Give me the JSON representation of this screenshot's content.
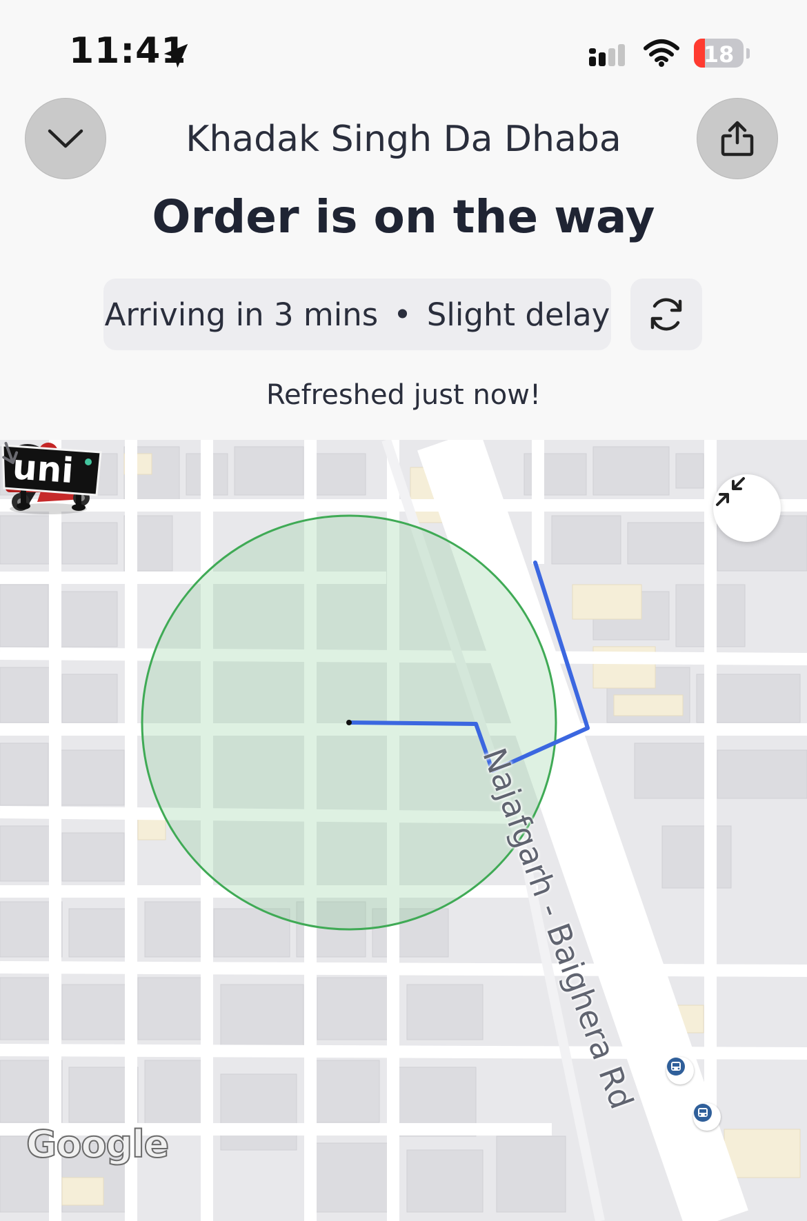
{
  "status_bar": {
    "time": "11:41",
    "battery": "18",
    "battery_color": "#ff3b30"
  },
  "header": {
    "restaurant_name": "Khadak Singh Da Dhaba",
    "order_status": "Order is on the way",
    "eta_text": "Arriving in 3 mins",
    "separator": "•",
    "delay_text": "Slight delay",
    "refreshed_text": "Refreshed just now!"
  },
  "map": {
    "road_name": "Najafgarh - Baighera Rd",
    "landmark_sign": "uni",
    "attribution": "Google",
    "route_color": "#3b67e0",
    "zone_color": "#4caf50",
    "icons": [
      "home-pin-icon",
      "delivery-scooter-icon",
      "bus-stop-icon",
      "fit-bounds-icon"
    ]
  },
  "colors": {
    "background": "#f8f8f8",
    "text_primary": "#1f2433",
    "pill_background": "#ededf0"
  }
}
